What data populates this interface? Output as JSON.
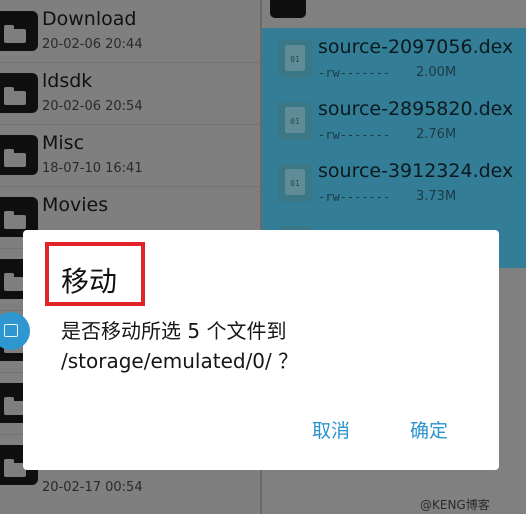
{
  "folders": [
    {
      "name": "Download",
      "date": "20-02-06 20:44"
    },
    {
      "name": "ldsdk",
      "date": "20-02-06 20:54"
    },
    {
      "name": "Misc",
      "date": "18-07-10 16:41"
    },
    {
      "name": "Movies",
      "date": ""
    },
    {
      "name": "",
      "date": "20-02-17 00:54"
    }
  ],
  "files": [
    {
      "name": "source-2097056.dex",
      "perm": "-rw-------",
      "size": "2.00M",
      "icon_label": "01"
    },
    {
      "name": "source-2895820.dex",
      "perm": "-rw-------",
      "size": "2.76M",
      "icon_label": "01"
    },
    {
      "name": "source-3912324.dex",
      "perm": "-rw-------",
      "size": "3.73M",
      "icon_label": "01"
    }
  ],
  "dialog": {
    "title": "移动",
    "message_line1": "是否移动所选 5 个文件到",
    "message_line2": "/storage/emulated/0/ ？",
    "cancel_label": "取消",
    "confirm_label": "确定"
  },
  "watermark": "@KENG博客",
  "colors": {
    "accent": "#2b93cf",
    "selection": "#337e96",
    "highlight_box": "#e2242a"
  }
}
